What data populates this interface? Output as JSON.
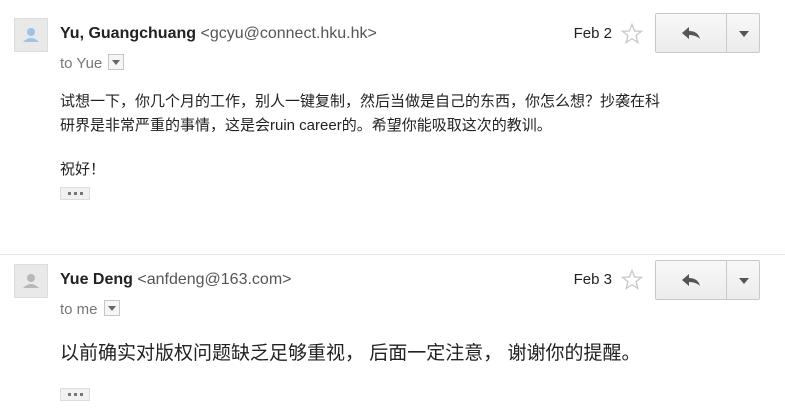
{
  "messages": [
    {
      "sender_name": "Yu, Guangchuang",
      "sender_email": "<gcyu@connect.hku.hk>",
      "recipient_label": "to Yue",
      "date": "Feb 2",
      "body_lines": [
        "试想一下，你几个月的工作，别人一键复制，然后当做是自己的东西，你怎么想？抄袭在科",
        "研界是非常严重的事情，这是会ruin career的。希望你能吸取这次的教训。",
        "",
        "祝好！"
      ]
    },
    {
      "sender_name": "Yue Deng",
      "sender_email": "<anfdeng@163.com>",
      "recipient_label": "to me",
      "date": "Feb 3",
      "body": "以前确实对版权问题缺乏足够重视， 后面一定注意， 谢谢你的提醒。"
    }
  ],
  "icons": {
    "avatar": "default-person-avatar",
    "star": "star-outline-icon",
    "reply": "reply-arrow-icon",
    "more": "chevron-down-icon",
    "trimmed": "ellipsis-icon"
  }
}
